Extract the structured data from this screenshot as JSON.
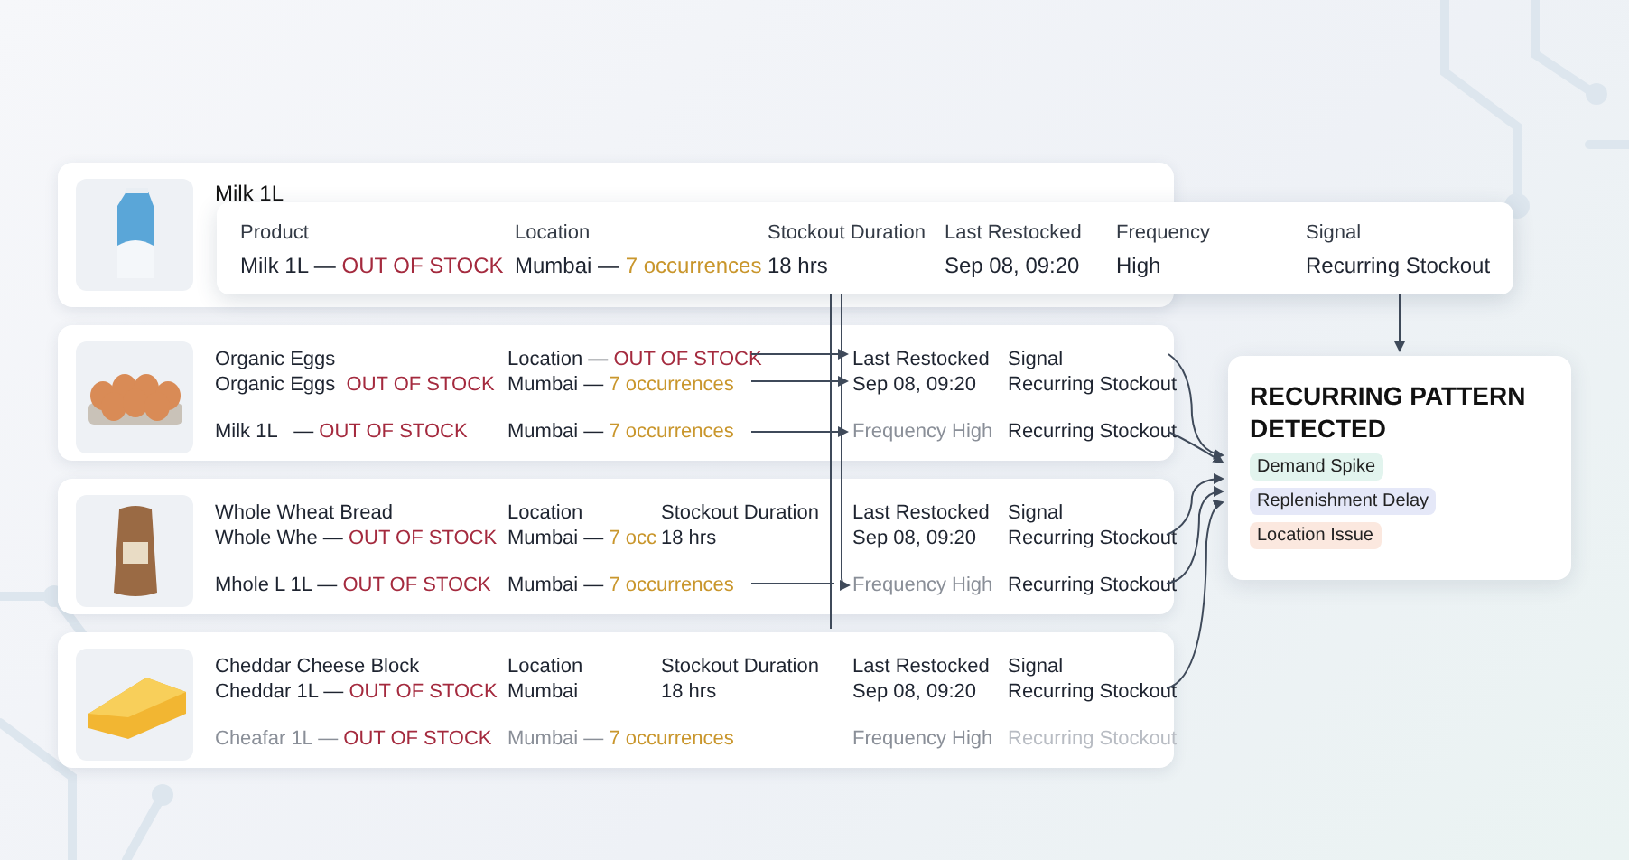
{
  "featured": {
    "name": "Milk 1L",
    "kind": "milk",
    "details": [
      {
        "label": "Product",
        "value": [
          {
            "text": "Milk 1L — ",
            "kind": "normal"
          },
          {
            "text": "OUT OF STOCK",
            "kind": "alert"
          }
        ]
      },
      {
        "label": "Location",
        "value": [
          {
            "text": "Mumbai — ",
            "kind": "normal"
          },
          {
            "text": "7 occurrences",
            "kind": "warn"
          }
        ]
      },
      {
        "label": "Stockout Duration",
        "value": [
          {
            "text": "18 hrs",
            "kind": "normal"
          }
        ]
      },
      {
        "label": "Last Restocked",
        "value": [
          {
            "text": "Sep 08, 09:20",
            "kind": "normal"
          }
        ]
      },
      {
        "label": "Frequency",
        "value": [
          {
            "text": "High",
            "kind": "normal"
          }
        ]
      },
      {
        "label": "Signal",
        "value": [
          {
            "text": "Recurring Stockout",
            "kind": "normal"
          }
        ]
      }
    ]
  },
  "products": [
    {
      "kind": "eggs",
      "lines": [
        {
          "product": [
            {
              "text": "Organic Eggs",
              "kind": "normal"
            }
          ],
          "location": [
            {
              "text": "Location — ",
              "kind": "normal"
            },
            {
              "text": "OUT OF STOCK",
              "kind": "alert"
            }
          ],
          "restocked": [
            {
              "text": "Last Restocked",
              "kind": "normal"
            }
          ],
          "signal": [
            {
              "text": "Signal",
              "kind": "normal"
            }
          ]
        },
        {
          "product": [
            {
              "text": "Organic Eggs  ",
              "kind": "normal"
            },
            {
              "text": "OUT OF STOCK",
              "kind": "alert"
            }
          ],
          "location": [
            {
              "text": "Mumbai — ",
              "kind": "normal"
            },
            {
              "text": "7 occurrences",
              "kind": "warn"
            }
          ],
          "restocked": [
            {
              "text": "Sep 08, 09:20",
              "kind": "normal"
            }
          ],
          "signal": [
            {
              "text": "Recurring Stockout",
              "kind": "normal"
            }
          ]
        },
        {
          "product": [
            {
              "text": "Milk 1L   — ",
              "kind": "normal"
            },
            {
              "text": "OUT OF STOCK",
              "kind": "alert"
            }
          ],
          "location": [
            {
              "text": "Mumbai — ",
              "kind": "normal"
            },
            {
              "text": "7 occurrences",
              "kind": "warn"
            }
          ],
          "restocked": [
            {
              "text": "Frequency High",
              "kind": "muted"
            }
          ],
          "signal": [
            {
              "text": "Recurring Stockout",
              "kind": "normal"
            }
          ]
        }
      ]
    },
    {
      "kind": "bread",
      "lines": [
        {
          "product": [
            {
              "text": "Whole Wheat Bread",
              "kind": "normal"
            }
          ],
          "location": [
            {
              "text": "Location",
              "kind": "normal"
            }
          ],
          "duration": [
            {
              "text": "Stockout Duration",
              "kind": "normal"
            }
          ],
          "restocked": [
            {
              "text": "Last Restocked",
              "kind": "normal"
            }
          ],
          "signal": [
            {
              "text": "Signal",
              "kind": "normal"
            }
          ]
        },
        {
          "product": [
            {
              "text": "Whole Whe — ",
              "kind": "normal"
            },
            {
              "text": "OUT OF STOCK",
              "kind": "alert"
            }
          ],
          "location": [
            {
              "text": "Mumbai — ",
              "kind": "normal"
            },
            {
              "text": "7 occ",
              "kind": "warn"
            }
          ],
          "duration": [
            {
              "text": "18 hrs",
              "kind": "normal"
            }
          ],
          "restocked": [
            {
              "text": "Sep 08, 09:20",
              "kind": "normal"
            }
          ],
          "signal": [
            {
              "text": "Recurring Stockout",
              "kind": "normal"
            }
          ]
        },
        {
          "product": [
            {
              "text": "Mhole L 1L — ",
              "kind": "normal"
            },
            {
              "text": "OUT OF STOCK",
              "kind": "alert"
            }
          ],
          "location": [
            {
              "text": "Mumbai — ",
              "kind": "normal"
            },
            {
              "text": "7 occurrences",
              "kind": "warn"
            }
          ],
          "restocked": [
            {
              "text": "Frequency High",
              "kind": "muted"
            }
          ],
          "signal": [
            {
              "text": "Recurring Stockout",
              "kind": "normal"
            }
          ]
        }
      ]
    },
    {
      "kind": "cheese",
      "lines": [
        {
          "product": [
            {
              "text": "Cheddar Cheese Block",
              "kind": "normal"
            }
          ],
          "location": [
            {
              "text": "Location",
              "kind": "normal"
            }
          ],
          "duration": [
            {
              "text": "Stockout Duration",
              "kind": "normal"
            }
          ],
          "restocked": [
            {
              "text": "Last Restocked",
              "kind": "normal"
            }
          ],
          "signal": [
            {
              "text": "Signal",
              "kind": "normal"
            }
          ]
        },
        {
          "product": [
            {
              "text": "Cheddar 1L — ",
              "kind": "normal"
            },
            {
              "text": "OUT OF STOCK",
              "kind": "alert"
            }
          ],
          "location": [
            {
              "text": "Mumbai",
              "kind": "normal"
            }
          ],
          "duration": [
            {
              "text": "18 hrs",
              "kind": "normal"
            }
          ],
          "restocked": [
            {
              "text": "Sep 08, 09:20",
              "kind": "normal"
            }
          ],
          "signal": [
            {
              "text": "Recurring Stockout",
              "kind": "normal"
            }
          ]
        },
        {
          "product": [
            {
              "text": "Cheafar 1L — ",
              "kind": "muted"
            },
            {
              "text": "OUT OF STOCK",
              "kind": "alert"
            }
          ],
          "location": [
            {
              "text": "Mumbai — ",
              "kind": "muted"
            },
            {
              "text": "7 occurrences",
              "kind": "warn"
            }
          ],
          "restocked": [
            {
              "text": "Frequency High",
              "kind": "muted"
            }
          ],
          "signal": [
            {
              "text": "Recurring Stockout",
              "kind": "faint"
            }
          ]
        }
      ]
    }
  ],
  "pattern": {
    "title": "RECURRING PATTERN DETECTED",
    "tags": [
      {
        "label": "Demand Spike",
        "color": "#e2f4ee"
      },
      {
        "label": "Replenishment Delay",
        "color": "#e5e8f8"
      },
      {
        "label": "Location Issue",
        "color": "#fbe8df"
      }
    ]
  }
}
